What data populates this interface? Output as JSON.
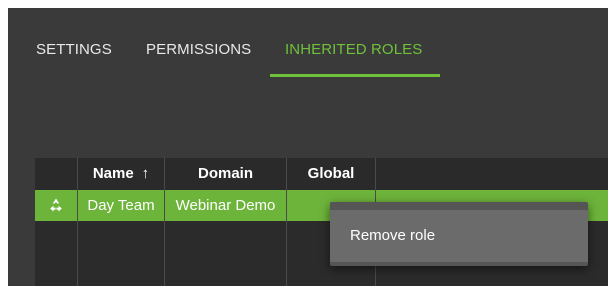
{
  "tabs": [
    {
      "label": "SETTINGS",
      "active": false
    },
    {
      "label": "PERMISSIONS",
      "active": false
    },
    {
      "label": "INHERITED ROLES",
      "active": true
    }
  ],
  "table": {
    "columns": [
      {
        "label": ""
      },
      {
        "label": "Name",
        "sort": "↑"
      },
      {
        "label": "Domain"
      },
      {
        "label": "Global"
      }
    ],
    "rows": [
      {
        "icon": "recycle-icon",
        "name": "Day Team",
        "domain": "Webinar Demo",
        "global": ""
      }
    ]
  },
  "context_menu": {
    "items": [
      {
        "label": "Remove role"
      }
    ]
  },
  "colors": {
    "accent": "#6fc13a",
    "row_selected": "#6db43b",
    "panel": "#3a3a3a",
    "menu": "#555555"
  }
}
